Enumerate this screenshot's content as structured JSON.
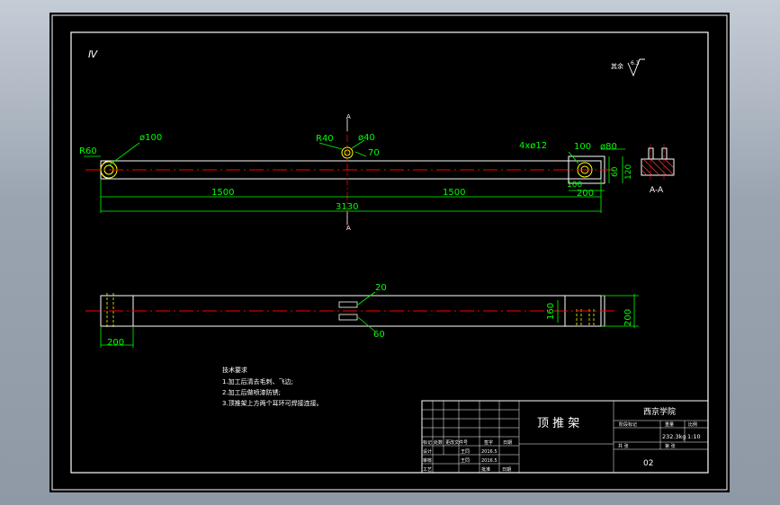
{
  "drawing": {
    "sheet_code": "Ⅳ",
    "roughness": {
      "label": "其余",
      "value": "6.3"
    },
    "front_view": {
      "dims": {
        "r60": "R60",
        "d100": "ø100",
        "r40": "R40",
        "d40": "ø40",
        "d70": "70",
        "holes": "4xø12",
        "w100": "100",
        "d80": "ø80",
        "h60": "60",
        "h120": "120",
        "w100b": "100",
        "w200": "200",
        "l1500a": "1500",
        "l1500b": "1500",
        "l3130": "3130"
      },
      "section_mark": "A"
    },
    "section": {
      "title": "A-A"
    },
    "top_view": {
      "dims": {
        "d20": "20",
        "d60": "60",
        "h160": "160",
        "h200": "200",
        "w200": "200"
      }
    },
    "notes": {
      "title": "技术要求",
      "items": [
        "1.加工后清去毛刺、飞边;",
        "2.加工后做喷漆防锈;",
        "3.顶推架上方两个耳环可焊接连接。"
      ]
    },
    "title_block": {
      "part_name": "顶 推 架",
      "school": "西京学院",
      "weight": "232.3kg",
      "scale": "1:10",
      "drawing_no": "02",
      "sheet_total": "共  张",
      "sheet_no": "第  张",
      "labels": {
        "mark": "标记",
        "count": "处数",
        "file_no": "更改文件号",
        "sign": "签字",
        "date": "日期",
        "design": "设计",
        "check": "审核",
        "approve": "工艺",
        "std": "标准化",
        "approve2": "批准",
        "stage": "阶段标记",
        "weight_h": "重量",
        "scale_h": "比例",
        "name1": "王同",
        "name2": "王同",
        "date1": "2016.5",
        "date2": "2016.5",
        "date_h": "日期"
      }
    }
  }
}
